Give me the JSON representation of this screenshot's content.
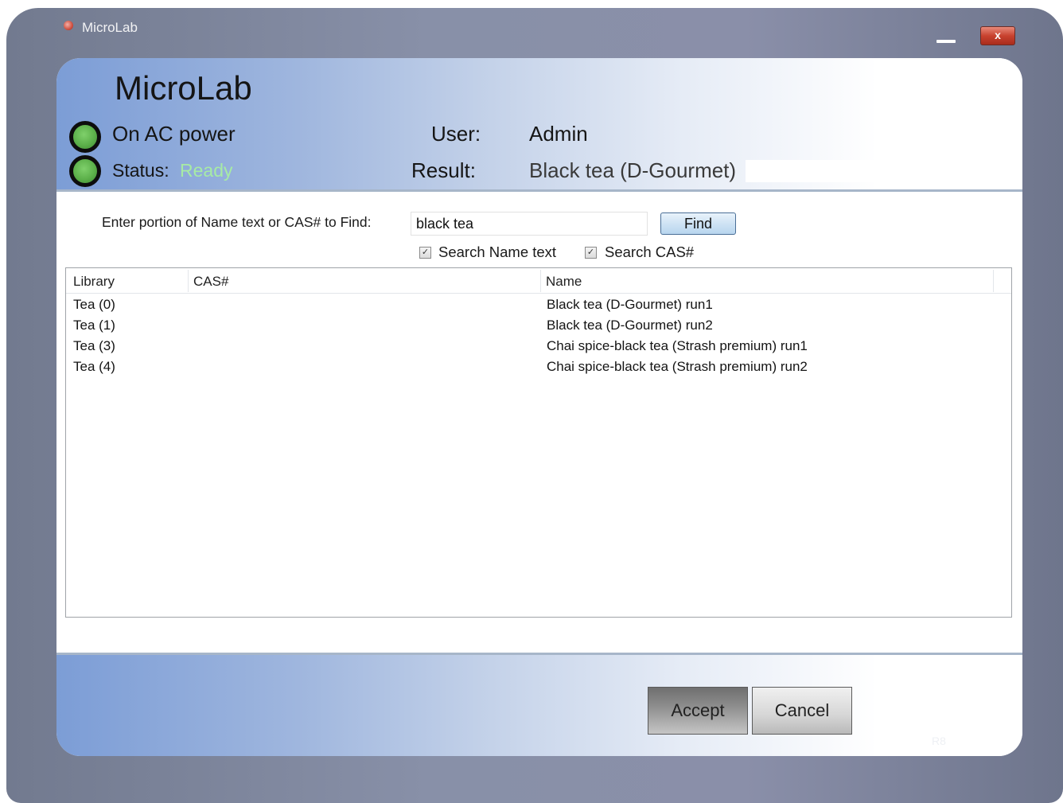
{
  "window": {
    "title": "MicroLab",
    "minimize_icon": "minimize-icon",
    "close_label": "x"
  },
  "header": {
    "app_name": "MicroLab",
    "power_text": "On AC power",
    "status_label": "Status:",
    "status_value": "Ready",
    "user_label": "User:",
    "user_value": "Admin",
    "result_label": "Result:",
    "result_value": "Black tea (D-Gourmet)",
    "led_color": "#5cb04a"
  },
  "search": {
    "prompt": "Enter portion of Name text or CAS# to Find:",
    "value": "black tea",
    "find_label": "Find",
    "search_name_label": "Search Name text",
    "search_name_checked": true,
    "search_cas_label": "Search CAS#",
    "search_cas_checked": true,
    "check_mark": "✓"
  },
  "results": {
    "columns": [
      "Library",
      "CAS#",
      "Name"
    ],
    "rows": [
      {
        "library": "Tea (0)",
        "cas": "",
        "name": "Black tea (D-Gourmet) run1"
      },
      {
        "library": "Tea (1)",
        "cas": "",
        "name": "Black tea (D-Gourmet) run2"
      },
      {
        "library": "Tea (3)",
        "cas": "",
        "name": "Chai spice-black tea (Strash premium) run1"
      },
      {
        "library": "Tea (4)",
        "cas": "",
        "name": "Chai spice-black tea (Strash premium) run2"
      }
    ]
  },
  "footer": {
    "accept_label": "Accept",
    "cancel_label": "Cancel",
    "build_tag": "R8"
  },
  "colors": {
    "accent_blue": "#7c9dd6",
    "frame": "#8890a8",
    "status_ready": "#a7eba5"
  }
}
